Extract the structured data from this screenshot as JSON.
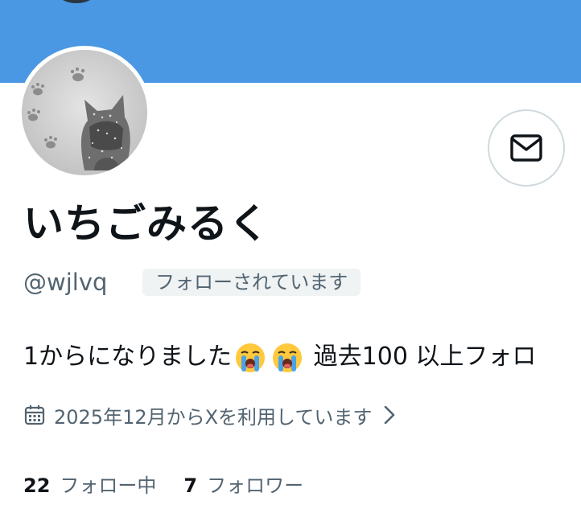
{
  "profile": {
    "display_name": "いちごみるく",
    "handle": "@wjlvq",
    "follows_you_badge": "フォローされています",
    "bio_text_1": "1からになりました",
    "bio_emoji": "loudly-crying-face",
    "bio_text_2": "過去100 以上フォロ",
    "joined_text": "2025年12月からXを利用しています",
    "following_count": "22",
    "following_label": "フォロー中",
    "followers_count": "7",
    "followers_label": "フォロワー"
  },
  "icons": {
    "dm": "mail-icon",
    "calendar": "calendar-icon",
    "chevron": "chevron-right-icon"
  },
  "colors": {
    "banner": "#4a97e3",
    "text_primary": "#0f1419",
    "text_secondary": "#536471",
    "badge_bg": "#eff3f4",
    "border": "#cfd9de"
  }
}
